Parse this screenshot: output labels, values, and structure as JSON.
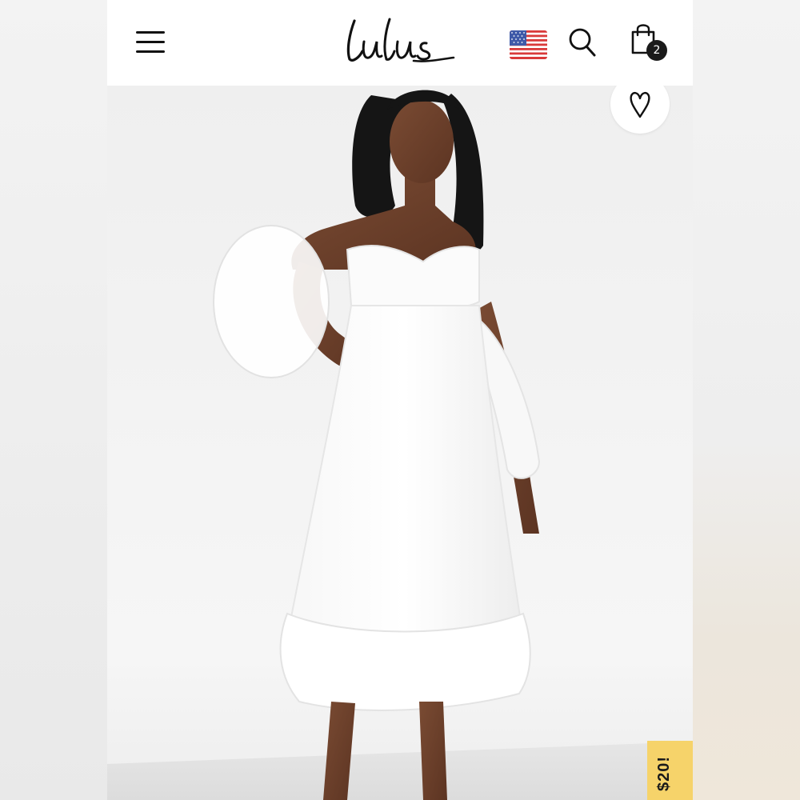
{
  "header": {
    "logo_text": "Lulus",
    "menu_icon": "hamburger-menu-icon",
    "flag_icon": "us-flag-icon",
    "search_icon": "search-icon",
    "bag_icon": "shopping-bag-icon",
    "bag_count": "2"
  },
  "product": {
    "image": "woman-in-white-off-shoulder-midi-dress",
    "wishlist_icon": "heart-icon"
  },
  "promo": {
    "label": "$20!",
    "color": "#f6d36a"
  }
}
